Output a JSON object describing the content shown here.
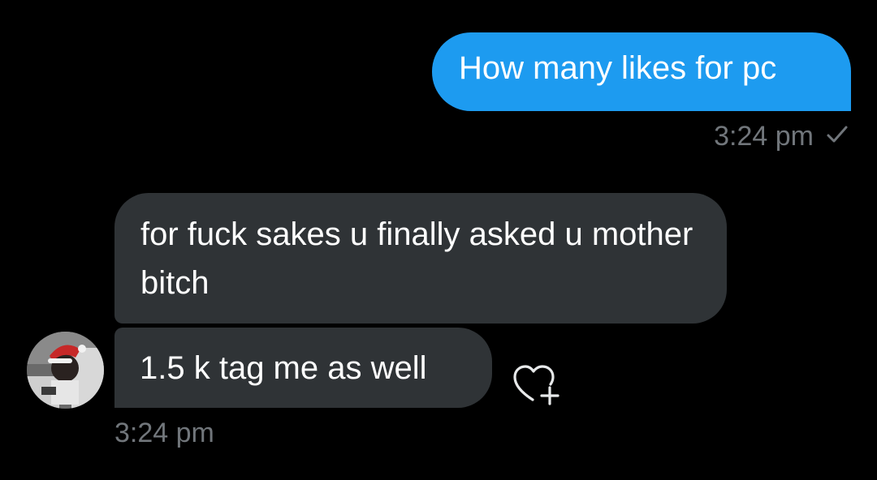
{
  "conversation": {
    "messages": [
      {
        "direction": "sent",
        "text": "How many likes for pc"
      },
      {
        "direction": "received",
        "text": "for fuck sakes u finally asked u mother bitch"
      },
      {
        "direction": "received",
        "text": "1.5 k tag me as well"
      }
    ],
    "sent_timestamp": "3:24 pm",
    "sent_status_icon": "checkmark-icon",
    "received_timestamp": "3:24 pm",
    "reaction_icon": "heart-plus-icon",
    "colors": {
      "background": "#000000",
      "sent_bubble": "#1d9bf0",
      "received_bubble": "#2f3336",
      "meta_text": "#71767b"
    }
  }
}
